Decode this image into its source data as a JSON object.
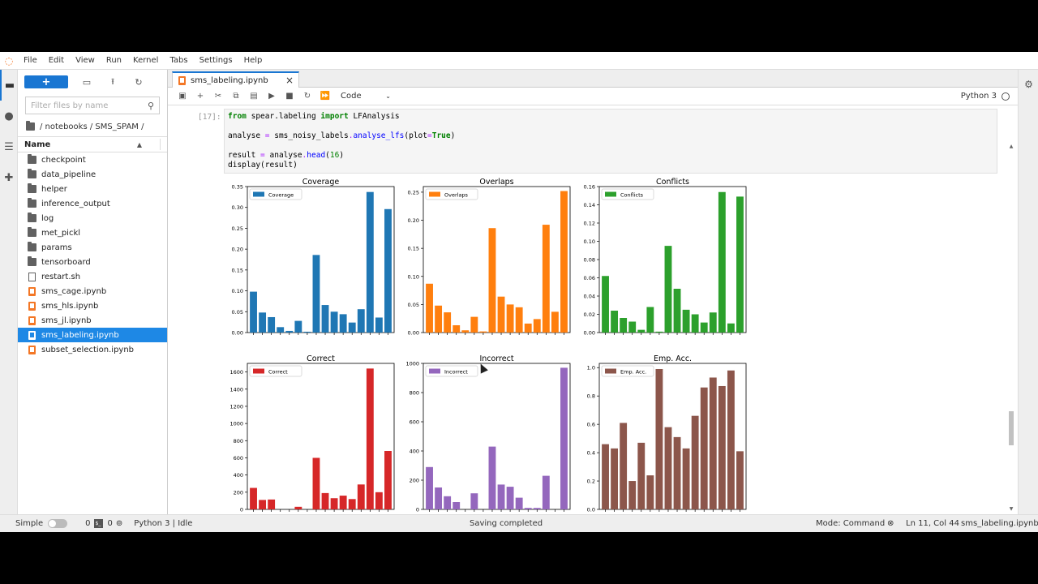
{
  "menu": [
    "File",
    "Edit",
    "View",
    "Run",
    "Kernel",
    "Tabs",
    "Settings",
    "Help"
  ],
  "filebrowser": {
    "filter_placeholder": "Filter files by name",
    "breadcrumb": "/ notebooks / SMS_SPAM /",
    "column_name": "Name",
    "items": [
      {
        "name": "checkpoint",
        "type": "folder"
      },
      {
        "name": "data_pipeline",
        "type": "folder"
      },
      {
        "name": "helper",
        "type": "folder"
      },
      {
        "name": "inference_output",
        "type": "folder"
      },
      {
        "name": "log",
        "type": "folder"
      },
      {
        "name": "met_pickl",
        "type": "folder"
      },
      {
        "name": "params",
        "type": "folder"
      },
      {
        "name": "tensorboard",
        "type": "folder"
      },
      {
        "name": "restart.sh",
        "type": "file"
      },
      {
        "name": "sms_cage.ipynb",
        "type": "notebook"
      },
      {
        "name": "sms_hls.ipynb",
        "type": "notebook"
      },
      {
        "name": "sms_jl.ipynb",
        "type": "notebook"
      },
      {
        "name": "sms_labeling.ipynb",
        "type": "notebook",
        "selected": true
      },
      {
        "name": "subset_selection.ipynb",
        "type": "notebook"
      }
    ]
  },
  "tab": {
    "title": "sms_labeling.ipynb",
    "close": "×"
  },
  "toolbar": {
    "cell_type": "Code",
    "kernel": "Python 3"
  },
  "cell": {
    "prompt": "[17]:",
    "code": {
      "l1_kw1": "from",
      "l1_mod": " spear.labeling ",
      "l1_kw2": "import",
      "l1_name": " LFAnalysis",
      "l2_a": "analyse ",
      "l2_eq": "=",
      "l2_b": " sms_noisy_labels",
      "l2_dot": ".",
      "l2_fn": "analyse_lfs",
      "l2_c": "(plot",
      "l2_eq2": "=",
      "l2_true": "True",
      "l2_d": ")",
      "l3_a": "result ",
      "l3_eq": "=",
      "l3_b": " analyse",
      "l3_dot": ".",
      "l3_fn": "head",
      "l3_c": "(",
      "l3_num": "16",
      "l3_d": ")",
      "l4": "display(result)"
    }
  },
  "chart_data": [
    {
      "type": "bar",
      "title": "Coverage",
      "legend": "Coverage",
      "color": "#1f77b4",
      "ylim": [
        0,
        0.35
      ],
      "yticks": [
        "0.00",
        "0.05",
        "0.10",
        "0.15",
        "0.20",
        "0.25",
        "0.30",
        "0.35"
      ],
      "values": [
        0.098,
        0.048,
        0.037,
        0.013,
        0.004,
        0.028,
        0.002,
        0.186,
        0.066,
        0.05,
        0.044,
        0.024,
        0.056,
        0.337,
        0.036,
        0.296
      ]
    },
    {
      "type": "bar",
      "title": "Overlaps",
      "legend": "Overlaps",
      "color": "#ff7f0e",
      "ylim": [
        0,
        0.26
      ],
      "yticks": [
        "0.00",
        "0.05",
        "0.10",
        "0.15",
        "0.20",
        "0.25"
      ],
      "values": [
        0.087,
        0.048,
        0.036,
        0.013,
        0.004,
        0.028,
        0.002,
        0.186,
        0.064,
        0.05,
        0.045,
        0.016,
        0.024,
        0.192,
        0.037,
        0.252
      ]
    },
    {
      "type": "bar",
      "title": "Conflicts",
      "legend": "Conflicts",
      "color": "#2ca02c",
      "ylim": [
        0,
        0.16
      ],
      "yticks": [
        "0.00",
        "0.02",
        "0.04",
        "0.06",
        "0.08",
        "0.10",
        "0.12",
        "0.14",
        "0.16"
      ],
      "values": [
        0.062,
        0.024,
        0.016,
        0.012,
        0.003,
        0.028,
        0.001,
        0.095,
        0.048,
        0.025,
        0.02,
        0.011,
        0.022,
        0.154,
        0.01,
        0.149
      ]
    },
    {
      "type": "bar",
      "title": "Correct",
      "legend": "Correct",
      "color": "#d62728",
      "ylim": [
        0,
        1700
      ],
      "yticks": [
        "0",
        "200",
        "400",
        "600",
        "800",
        "1000",
        "1200",
        "1400",
        "1600"
      ],
      "values": [
        250,
        110,
        115,
        0,
        0,
        30,
        0,
        600,
        190,
        130,
        160,
        120,
        290,
        1640,
        200,
        680
      ]
    },
    {
      "type": "bar",
      "title": "Incorrect",
      "legend": "Incorrect",
      "color": "#9467bd",
      "ylim": [
        0,
        1000
      ],
      "yticks": [
        "0",
        "200",
        "400",
        "600",
        "800",
        "1000"
      ],
      "values": [
        290,
        150,
        90,
        50,
        0,
        110,
        0,
        430,
        170,
        155,
        80,
        10,
        10,
        230,
        0,
        970
      ]
    },
    {
      "type": "bar",
      "title": "Emp. Acc.",
      "legend": "Emp. Acc.",
      "color": "#8c564b",
      "ylim": [
        0,
        1.03
      ],
      "yticks": [
        "0.0",
        "0.2",
        "0.4",
        "0.6",
        "0.8",
        "1.0"
      ],
      "values": [
        0.46,
        0.43,
        0.61,
        0.2,
        0.47,
        0.24,
        0.99,
        0.58,
        0.51,
        0.43,
        0.66,
        0.86,
        0.93,
        0.87,
        0.98,
        0.41
      ]
    }
  ],
  "status": {
    "mode_label": "Simple",
    "terminals": "0",
    "kernels": "0",
    "kernel_state": "Python 3 | Idle",
    "message": "Saving completed",
    "mode": "Mode: Command",
    "position": "Ln 11, Col 44",
    "filename": "sms_labeling.ipynb"
  }
}
